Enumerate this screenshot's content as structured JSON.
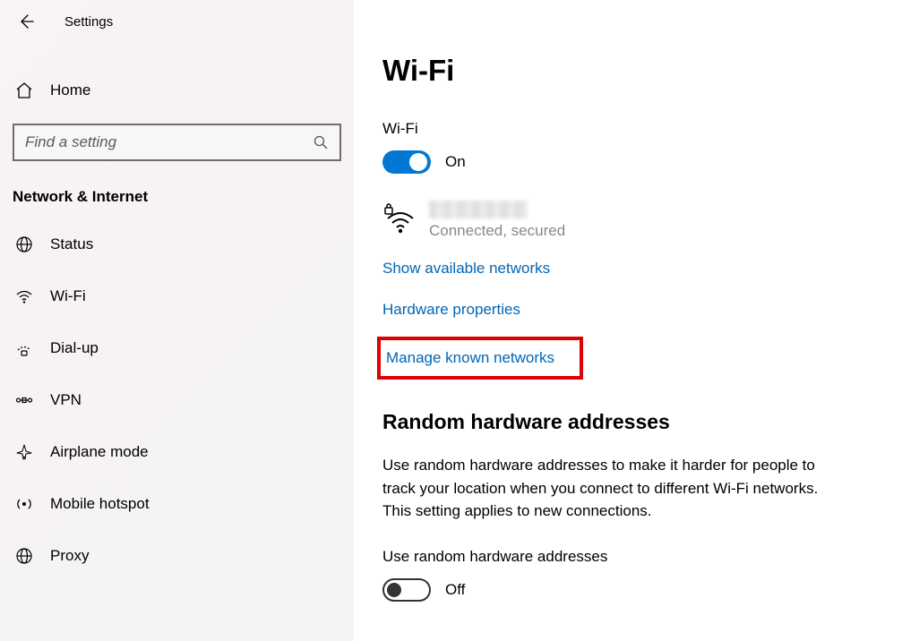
{
  "header": {
    "title": "Settings"
  },
  "sidebar": {
    "home_label": "Home",
    "search_placeholder": "Find a setting",
    "section_heading": "Network & Internet",
    "items": [
      {
        "label": "Status"
      },
      {
        "label": "Wi-Fi"
      },
      {
        "label": "Dial-up"
      },
      {
        "label": "VPN"
      },
      {
        "label": "Airplane mode"
      },
      {
        "label": "Mobile hotspot"
      },
      {
        "label": "Proxy"
      }
    ]
  },
  "main": {
    "title": "Wi-Fi",
    "wifi_toggle": {
      "heading": "Wi-Fi",
      "state_label": "On"
    },
    "current_network": {
      "status": "Connected, secured"
    },
    "links": {
      "show_available": "Show available networks",
      "hardware_props": "Hardware properties",
      "manage_known": "Manage known networks"
    },
    "random_hw": {
      "heading": "Random hardware addresses",
      "body": "Use random hardware addresses to make it harder for people to track your location when you connect to different Wi-Fi networks. This setting applies to new connections.",
      "toggle_heading": "Use random hardware addresses",
      "state_label": "Off"
    }
  }
}
